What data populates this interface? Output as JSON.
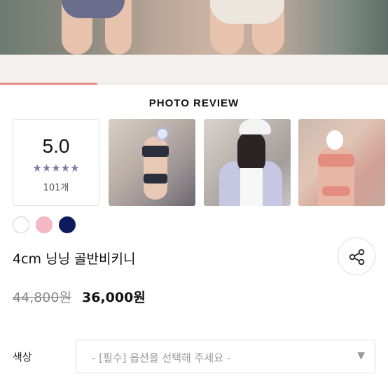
{
  "section": {
    "title": "PHOTO REVIEW"
  },
  "top_progress": {
    "fraction": 0.25
  },
  "rating": {
    "score": "5.0",
    "stars": "★★★★★",
    "count": "101개"
  },
  "colors": {
    "accent": "#e98d8a",
    "star": "#7d79a8",
    "swatch_white": "#ffffff",
    "swatch_pink": "#f6b8c4",
    "swatch_navy": "#0d1a5e"
  },
  "product": {
    "name": "4cm 닝닝 골반비키니",
    "original_price": "44,800원",
    "sale_price": "36,000원"
  },
  "option": {
    "label": "색상",
    "placeholder": "- [필수] 옵션을 선택해 주세요 -",
    "caret": "▼"
  }
}
